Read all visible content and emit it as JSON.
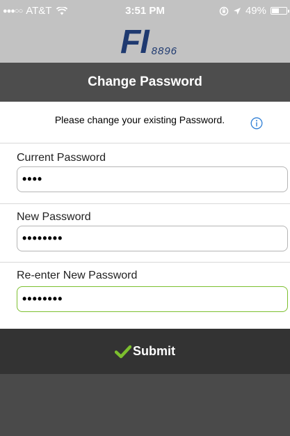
{
  "status": {
    "signal": "●●●○○",
    "carrier": "AT&T",
    "time": "3:51 PM",
    "battery": "49%",
    "battery_level": 0.49
  },
  "logo": {
    "main": "FI",
    "sub": "8896",
    "color": "#1f3a70"
  },
  "header": {
    "title": "Change Password"
  },
  "instruction": {
    "text": "Please change your existing Password."
  },
  "form": {
    "current": {
      "label": "Current Password",
      "value": "••••"
    },
    "new": {
      "label": "New Password",
      "value": "••••••••"
    },
    "reenter": {
      "label": "Re-enter New Password",
      "value": "••••••••"
    }
  },
  "submit": {
    "label": "Submit",
    "icon": "check-icon"
  },
  "colors": {
    "accent_green": "#7cbf2e",
    "info_blue": "#2f7fd6",
    "header_bg": "#4d4d4d",
    "submit_bg": "#333333"
  }
}
